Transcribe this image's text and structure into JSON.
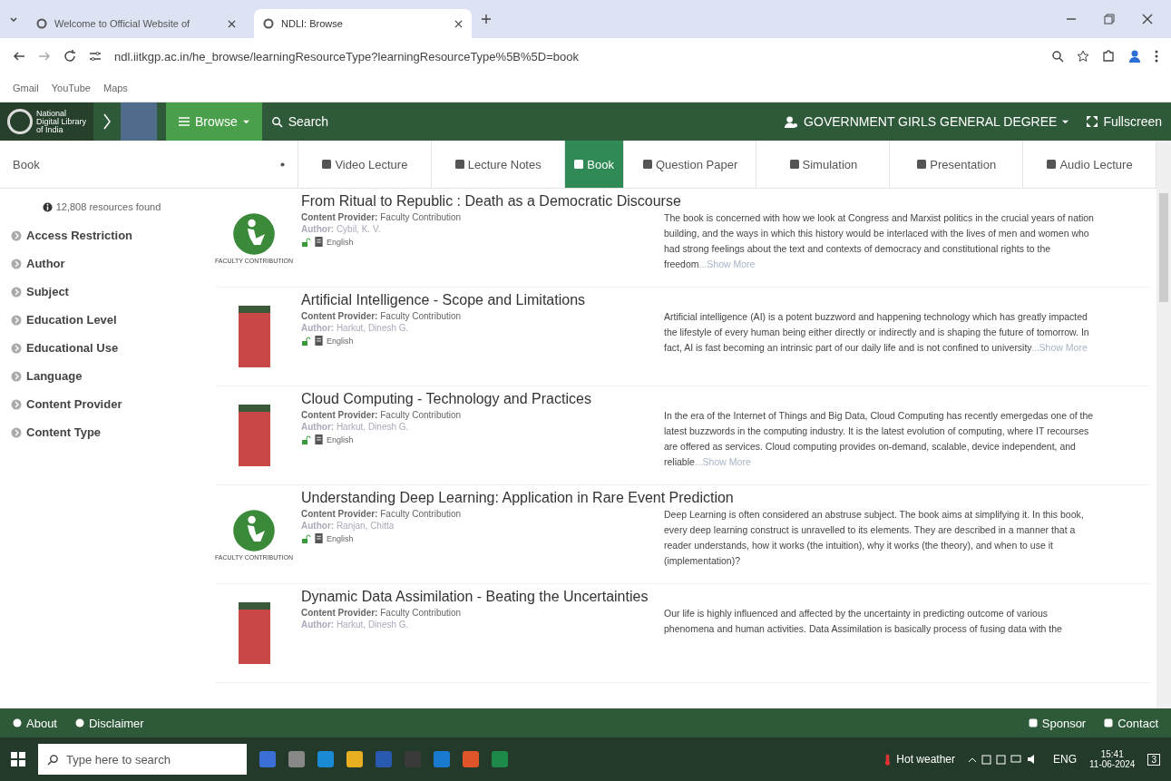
{
  "browser": {
    "tabs": [
      {
        "title": "Welcome to Official Website of",
        "selected": false
      },
      {
        "title": "NDLI: Browse",
        "selected": true
      }
    ],
    "url": "ndl.iitkgp.ac.in/he_browse/learningResourceType?learningResourceType%5B%5D=book",
    "bookmarks": [
      "Gmail",
      "YouTube",
      "Maps"
    ]
  },
  "site_nav": {
    "logo_text": [
      "National",
      "Digital Library",
      "of India"
    ],
    "browse": "Browse",
    "search": "Search",
    "institution": "GOVERNMENT GIRLS GENERAL DEGREE",
    "fullscreen": "Fullscreen"
  },
  "type_select": "Book",
  "type_tabs": [
    {
      "label": "Video Lecture",
      "selected": false
    },
    {
      "label": "Lecture Notes",
      "selected": false
    },
    {
      "label": "Book",
      "selected": true
    },
    {
      "label": "Question Paper",
      "selected": false
    },
    {
      "label": "Simulation",
      "selected": false
    },
    {
      "label": "Presentation",
      "selected": false
    },
    {
      "label": "Audio Lecture",
      "selected": false
    }
  ],
  "results_count": "12,808 resources found",
  "filters": [
    "Access Restriction",
    "Author",
    "Subject",
    "Education Level",
    "Educational Use",
    "Language",
    "Content Provider",
    "Content Type"
  ],
  "results": [
    {
      "kind": "logo",
      "thumb_caption": "FACULTY CONTRIBUTION",
      "title": "From Ritual to Republic : Death as a Democratic Discourse",
      "provider_label": "Content Provider:",
      "provider": "Faculty Contribution",
      "author_label": "Author:",
      "author": "Cybil, K. V.",
      "language": "English",
      "description": "The book is concerned with how we look at Congress and Marxist politics in the crucial years of nation building, and the ways in which this history would be interlaced with the lives of men and women who had strong feelings about the text and contexts of democracy and constitutional rights to the freedom",
      "more": "...Show More"
    },
    {
      "kind": "cover",
      "title": "Artificial Intelligence - Scope and Limitations",
      "provider_label": "Content Provider:",
      "provider": "Faculty Contribution",
      "author_label": "Author:",
      "author": "Harkut, Dinesh G.",
      "language": "English",
      "description": "Artificial intelligence (AI) is a potent buzzword and happening technology which has greatly impacted the lifestyle of every human being either directly or indirectly and is shaping the future of tomorrow. In fact, AI is fast becoming an intrinsic part of our daily life and is not confined to university",
      "more": "...Show More"
    },
    {
      "kind": "cover",
      "title": "Cloud Computing - Technology and Practices",
      "provider_label": "Content Provider:",
      "provider": "Faculty Contribution",
      "author_label": "Author:",
      "author": "Harkut, Dinesh G.",
      "language": "English",
      "description": "In the era of the Internet of Things and Big Data, Cloud Computing has recently emergedas one of the latest buzzwords in the computing industry. It is the latest evolution of computing, where IT recourses are offered as services. Cloud computing provides on-demand, scalable, device independent, and reliable",
      "more": "...Show More"
    },
    {
      "kind": "logo",
      "thumb_caption": "FACULTY CONTRIBUTION",
      "title": "Understanding Deep Learning: Application in Rare Event Prediction",
      "provider_label": "Content Provider:",
      "provider": "Faculty Contribution",
      "author_label": "Author:",
      "author": "Ranjan, Chitta",
      "language": "English",
      "description": "Deep Learning is often considered an abstruse subject. The book aims at simplifying it. In this book, every deep learning construct is unravelled to its elements. They are described in a manner that a reader understands, how it works (the intuition), why it works (the theory), and when to use it (implementation)?"
    },
    {
      "kind": "cover",
      "title": "Dynamic Data Assimilation - Beating the Uncertainties",
      "provider_label": "Content Provider:",
      "provider": "Faculty Contribution",
      "author_label": "Author:",
      "author": "Harkut, Dinesh G.",
      "description": "Our life is highly influenced and affected by the uncertainty in predicting outcome of various phenomena and human activities. Data Assimilation is basically process of fusing data with the"
    }
  ],
  "footer": {
    "left": [
      "About",
      "Disclaimer"
    ],
    "right": [
      "Sponsor",
      "Contact"
    ]
  },
  "taskbar": {
    "search_placeholder": "Type here to search",
    "weather": "Hot weather",
    "lang": "ENG",
    "time": "15:41",
    "date": "11-06-2024",
    "notifications": "3"
  }
}
